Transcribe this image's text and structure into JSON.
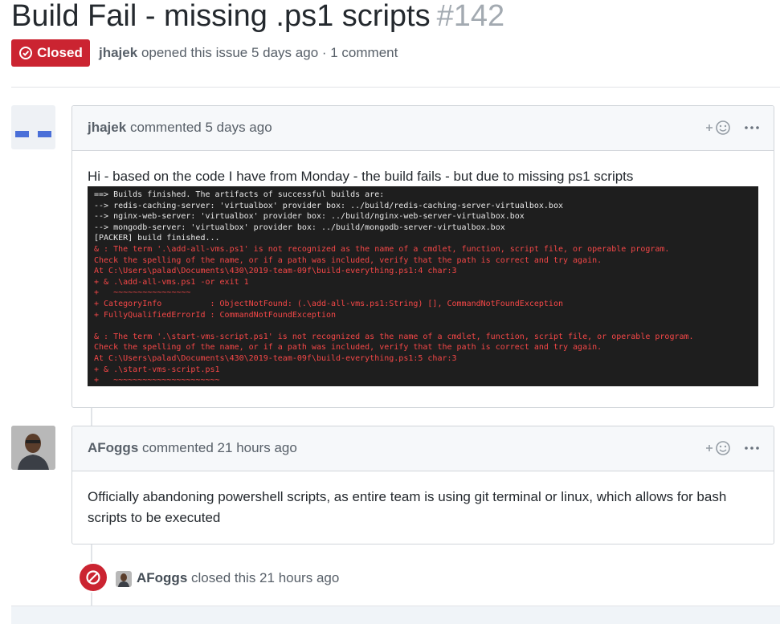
{
  "issue": {
    "title": "Build Fail - missing .ps1 scripts",
    "number": "#142",
    "state": "Closed",
    "author": "jhajek",
    "opened_text": "opened this issue 5 days ago · 1 comment"
  },
  "comments": [
    {
      "author": "jhajek",
      "action": "commented 5 days ago",
      "body": "Hi - based on the code I have from Monday - the build fails - but due to missing ps1 scripts",
      "terminal": [
        {
          "t": "ok",
          "text": "==> Builds finished. The artifacts of successful builds are:"
        },
        {
          "t": "ok",
          "text": "--> redis-caching-server: 'virtualbox' provider box: ../build/redis-caching-server-virtualbox.box"
        },
        {
          "t": "ok",
          "text": "--> nginx-web-server: 'virtualbox' provider box: ../build/nginx-web-server-virtualbox.box"
        },
        {
          "t": "ok",
          "text": "--> mongodb-server: 'virtualbox' provider box: ../build/mongodb-server-virtualbox.box"
        },
        {
          "t": "ok",
          "text": "[PACKER] build finished..."
        },
        {
          "t": "err",
          "text": "& : The term '.\\add-all-vms.ps1' is not recognized as the name of a cmdlet, function, script file, or operable program."
        },
        {
          "t": "err",
          "text": "Check the spelling of the name, or if a path was included, verify that the path is correct and try again."
        },
        {
          "t": "err",
          "text": "At C:\\Users\\palad\\Documents\\430\\2019-team-09f\\build-everything.ps1:4 char:3"
        },
        {
          "t": "err",
          "text": "+ & .\\add-all-vms.ps1 -or exit 1"
        },
        {
          "t": "err",
          "text": "+   ~~~~~~~~~~~~~~~~"
        },
        {
          "t": "err",
          "text": "+ CategoryInfo          : ObjectNotFound: (.\\add-all-vms.ps1:String) [], CommandNotFoundException"
        },
        {
          "t": "err",
          "text": "+ FullyQualifiedErrorId : CommandNotFoundException"
        },
        {
          "t": "blank",
          "text": ""
        },
        {
          "t": "err",
          "text": "& : The term '.\\start-vms-script.ps1' is not recognized as the name of a cmdlet, function, script file, or operable program."
        },
        {
          "t": "err",
          "text": "Check the spelling of the name, or if a path was included, verify that the path is correct and try again."
        },
        {
          "t": "err",
          "text": "At C:\\Users\\palad\\Documents\\430\\2019-team-09f\\build-everything.ps1:5 char:3"
        },
        {
          "t": "err",
          "text": "+ & .\\start-vms-script.ps1"
        },
        {
          "t": "err",
          "text": "+   ~~~~~~~~~~~~~~~~~~~~~~"
        }
      ]
    },
    {
      "author": "AFoggs",
      "action": "commented 21 hours ago",
      "body": "Officially abandoning powershell scripts, as entire team is using git terminal or linux, which allows for bash scripts to be executed"
    }
  ],
  "close_event": {
    "author": "AFoggs",
    "text": "closed this 21 hours ago"
  },
  "icons": {
    "state": "issue-closed-icon",
    "reaction": "smiley-icon",
    "more": "kebab-horizontal-icon",
    "close_event": "circle-slash-icon"
  },
  "colors": {
    "closed_red": "#cb2431",
    "link_gray": "#586069",
    "header_bg": "#f6f8fa",
    "border": "#d1d5da",
    "terminal_bg": "#1e1e1e",
    "terminal_err": "#f44747"
  }
}
